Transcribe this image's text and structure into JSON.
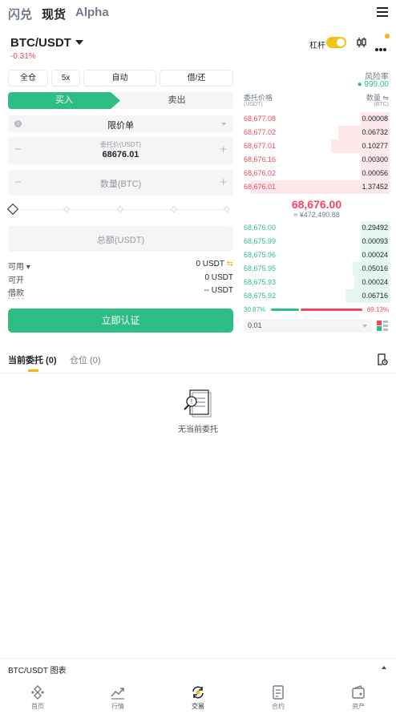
{
  "top_tabs": [
    "闪兑",
    "现货",
    "Alpha"
  ],
  "pair": {
    "symbol": "BTC/USDT",
    "change": "-0.31%",
    "leverage_label": "杠杆"
  },
  "mode_buttons": [
    "全仓",
    "5x",
    "自动",
    "借/还"
  ],
  "side": {
    "buy": "买入",
    "sell": "卖出"
  },
  "order_type": "限价单",
  "price_field": {
    "label": "委托价(USDT)",
    "value": "68676.01",
    "minus": "−",
    "plus": "+"
  },
  "qty_field": {
    "placeholder": "数量(BTC)"
  },
  "total_field": {
    "placeholder": "总额(USDT)"
  },
  "balances": [
    {
      "label": "可用",
      "value": "0 USDT"
    },
    {
      "label": "可开",
      "value": "0 USDT"
    },
    {
      "label": "借款",
      "value": "-- USDT"
    }
  ],
  "verify_button": "立即认证",
  "orderbook": {
    "risk_label": "风险率",
    "risk_value": "999.00",
    "price_header": "委托价格",
    "price_unit": "(USDT)",
    "qty_header": "数量",
    "qty_unit": "(BTC)",
    "asks": [
      {
        "price": "68,677.08",
        "qty": "0.00008"
      },
      {
        "price": "68,677.02",
        "qty": "0.06732"
      },
      {
        "price": "68,677.01",
        "qty": "0.10277"
      },
      {
        "price": "68,676.16",
        "qty": "0.00300"
      },
      {
        "price": "68,676.02",
        "qty": "0.00056"
      },
      {
        "price": "68,676.01",
        "qty": "1.37452"
      }
    ],
    "mid_price": "68,676.00",
    "mid_fiat": "≈ ¥472,490.88",
    "bids": [
      {
        "price": "68,676.00",
        "qty": "0.29492"
      },
      {
        "price": "68,675.99",
        "qty": "0.00093"
      },
      {
        "price": "68,675.96",
        "qty": "0.00024"
      },
      {
        "price": "68,675.95",
        "qty": "0.05016"
      },
      {
        "price": "68,675.93",
        "qty": "0.00024"
      },
      {
        "price": "68,675.92",
        "qty": "0.06716"
      }
    ],
    "buy_ratio": "30.87%",
    "sell_ratio": "69.13%",
    "depth": "0.01"
  },
  "order_tabs": [
    "当前委托 (0)",
    "仓位 (0)"
  ],
  "empty_text": "无当前委托",
  "chart_toggle": "BTC/USDT 图表",
  "bottom_nav": [
    "首页",
    "行情",
    "交易",
    "合约",
    "资产"
  ],
  "colors": {
    "buy": "#2ebd85",
    "sell": "#f6465d",
    "accent": "#f0b90b"
  }
}
